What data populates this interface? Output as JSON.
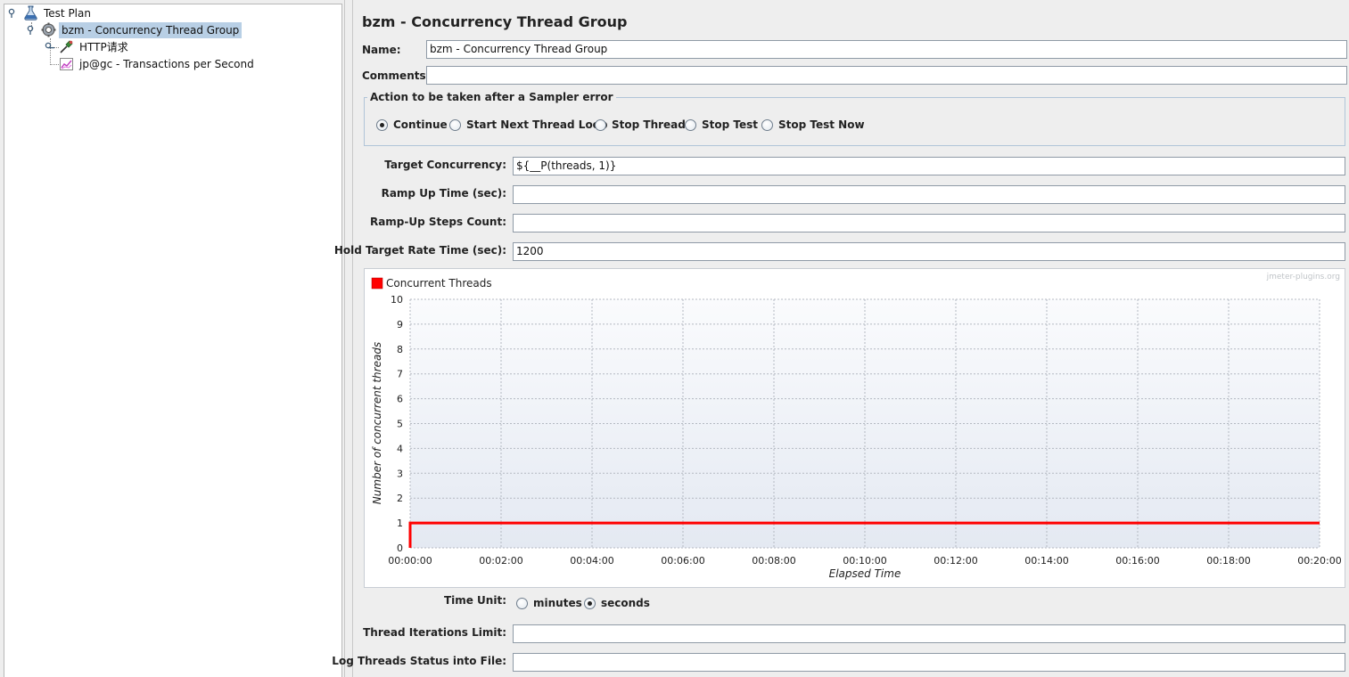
{
  "tree": {
    "items": [
      {
        "label": "Test Plan",
        "icon": "test-plan-icon"
      },
      {
        "label": "bzm - Concurrency Thread Group",
        "icon": "thread-group-icon",
        "selected": true
      },
      {
        "label": "HTTP请求",
        "icon": "http-sampler-icon"
      },
      {
        "label": "jp@gc - Transactions per Second",
        "icon": "graph-listener-icon"
      }
    ]
  },
  "panel": {
    "title": "bzm - Concurrency Thread Group",
    "name_label": "Name:",
    "name_value": "bzm - Concurrency Thread Group",
    "comments_label": "Comments:",
    "comments_value": "",
    "sampler_error": {
      "legend": "Action to be taken after a Sampler error",
      "options": [
        "Continue",
        "Start Next Thread Loop",
        "Stop Thread",
        "Stop Test",
        "Stop Test Now"
      ],
      "selected": "Continue"
    },
    "target_concurrency_label": "Target Concurrency:",
    "target_concurrency_value": "${__P(threads, 1)}",
    "ramp_up_label": "Ramp Up Time (sec):",
    "ramp_up_value": "",
    "steps_label": "Ramp-Up Steps Count:",
    "steps_value": "",
    "hold_label": "Hold Target Rate Time (sec):",
    "hold_value": "1200",
    "time_unit_label": "Time Unit:",
    "time_unit_options": [
      "minutes",
      "seconds"
    ],
    "time_unit_selected": "seconds",
    "iterations_label": "Thread Iterations Limit:",
    "iterations_value": "",
    "log_label": "Log Threads Status into File:",
    "log_value": ""
  },
  "chart_data": {
    "type": "line",
    "watermark": "jmeter-plugins.org",
    "xlabel": "Elapsed Time",
    "ylabel": "Number of concurrent threads",
    "xlim": [
      0,
      1200
    ],
    "ylim": [
      0,
      10
    ],
    "x_ticks": [
      "00:00:00",
      "00:02:00",
      "00:04:00",
      "00:06:00",
      "00:08:00",
      "00:10:00",
      "00:12:00",
      "00:14:00",
      "00:16:00",
      "00:18:00",
      "00:20:00"
    ],
    "y_ticks": [
      "0",
      "1",
      "2",
      "3",
      "4",
      "5",
      "6",
      "7",
      "8",
      "9",
      "10"
    ],
    "grid": true,
    "legend_position": "top-left",
    "series": [
      {
        "name": "Concurrent Threads",
        "color": "#ff0000",
        "x": [
          0,
          0,
          1200
        ],
        "y": [
          0,
          1,
          1
        ]
      }
    ]
  }
}
